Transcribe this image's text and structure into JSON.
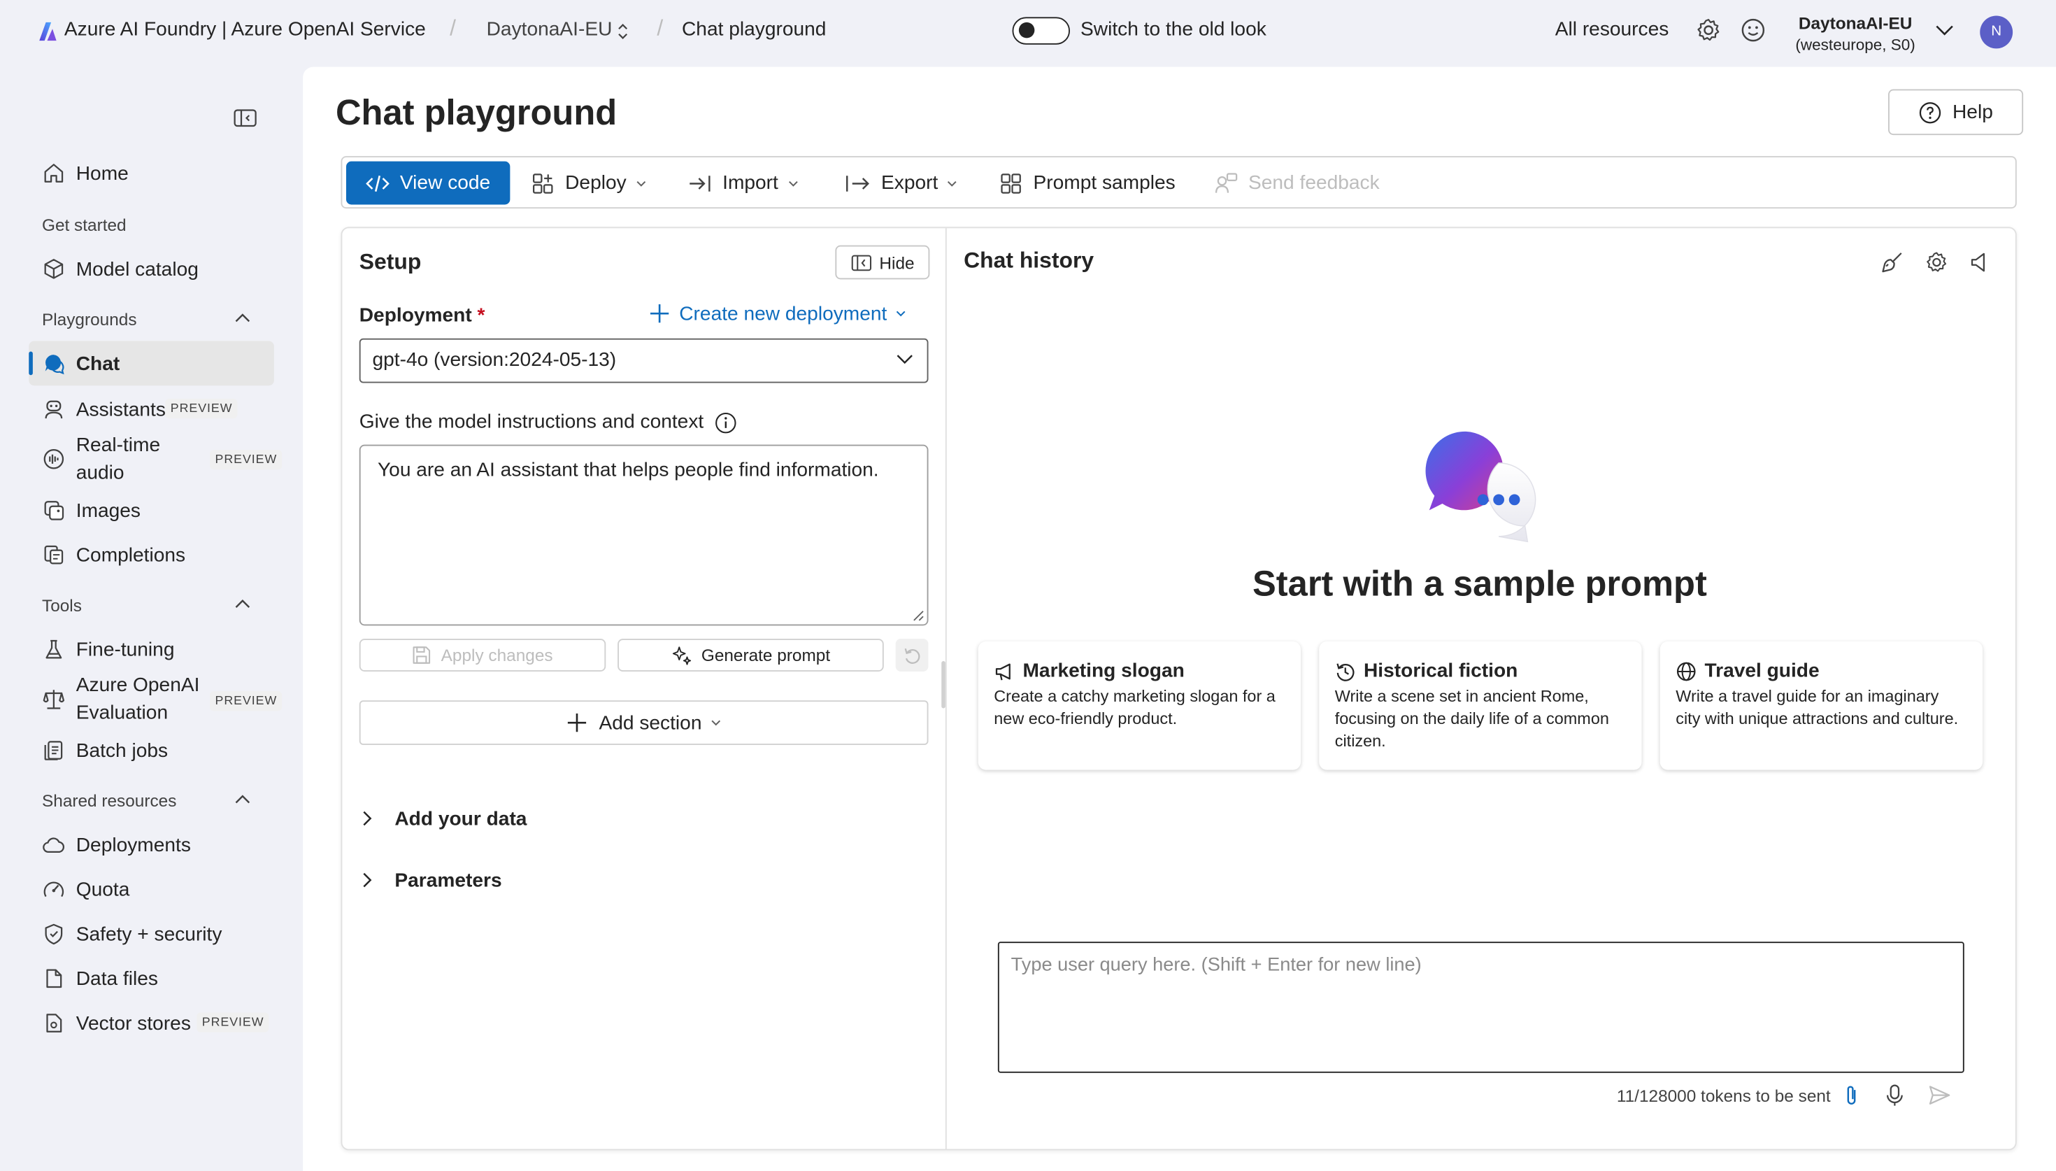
{
  "topbar": {
    "brand": "Azure AI Foundry | Azure OpenAI Service",
    "resource": "DaytonaAI-EU",
    "page": "Chat playground",
    "toggle_label": "Switch to the old look",
    "all_resources": "All resources",
    "account_name": "DaytonaAI-EU",
    "account_region": "(westeurope, S0)",
    "avatar_initial": "N",
    "icons": [
      "settings-icon",
      "feedback-smiley-icon",
      "chevron-down-icon"
    ]
  },
  "sidebar": {
    "home": "Home",
    "get_started": "Get started",
    "model_catalog": "Model catalog",
    "playgrounds": "Playgrounds",
    "chat": "Chat",
    "assistants": "Assistants",
    "realtime_audio_l1": "Real-time",
    "realtime_audio_l2": "audio",
    "images": "Images",
    "completions": "Completions",
    "tools": "Tools",
    "fine_tuning": "Fine-tuning",
    "evaluation_l1": "Azure OpenAI",
    "evaluation_l2": "Evaluation",
    "batch_jobs": "Batch jobs",
    "shared_resources": "Shared resources",
    "deployments": "Deployments",
    "quota": "Quota",
    "safety_security": "Safety + security",
    "data_files": "Data files",
    "vector_stores": "Vector stores",
    "preview_badge": "PREVIEW"
  },
  "main": {
    "title": "Chat playground",
    "help": "Help",
    "toolbar": {
      "view_code": "View code",
      "deploy": "Deploy",
      "import": "Import",
      "export": "Export",
      "prompt_samples": "Prompt samples",
      "send_feedback": "Send feedback"
    }
  },
  "setup": {
    "title": "Setup",
    "hide": "Hide",
    "deployment_label": "Deployment",
    "required_mark": "*",
    "create_deployment": "Create new deployment",
    "deployment_value": "gpt-4o (version:2024-05-13)",
    "instructions_label": "Give the model instructions and context",
    "system_message": "You are an AI assistant that helps people find information.",
    "apply_changes": "Apply changes",
    "generate_prompt": "Generate prompt",
    "add_section": "Add section",
    "add_your_data": "Add your data",
    "parameters": "Parameters"
  },
  "chat": {
    "title": "Chat history",
    "hero_title": "Start with a sample prompt",
    "samples": [
      {
        "title": "Marketing slogan",
        "desc": "Create a catchy marketing slogan for a new eco-friendly product."
      },
      {
        "title": "Historical fiction",
        "desc": "Write a scene set in ancient Rome, focusing on the daily life of a common citizen."
      },
      {
        "title": "Travel guide",
        "desc": "Write a travel guide for an imaginary city with unique attractions and culture."
      }
    ],
    "query_placeholder": "Type user query here. (Shift + Enter for new line)",
    "tokens": "11/128000 tokens to be sent"
  },
  "colors": {
    "accent": "#0f6cbd",
    "avatar": "#5b5fc7",
    "required": "#c50f1f",
    "background": "#f0f1f7"
  }
}
